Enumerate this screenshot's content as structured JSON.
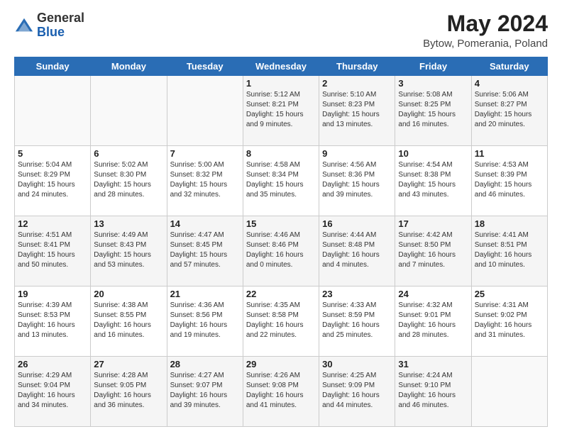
{
  "logo": {
    "text_general": "General",
    "text_blue": "Blue"
  },
  "header": {
    "title": "May 2024",
    "subtitle": "Bytow, Pomerania, Poland"
  },
  "days_of_week": [
    "Sunday",
    "Monday",
    "Tuesday",
    "Wednesday",
    "Thursday",
    "Friday",
    "Saturday"
  ],
  "weeks": [
    [
      {
        "day": "",
        "sunrise": "",
        "sunset": "",
        "daylight": ""
      },
      {
        "day": "",
        "sunrise": "",
        "sunset": "",
        "daylight": ""
      },
      {
        "day": "",
        "sunrise": "",
        "sunset": "",
        "daylight": ""
      },
      {
        "day": "1",
        "sunrise": "Sunrise: 5:12 AM",
        "sunset": "Sunset: 8:21 PM",
        "daylight": "Daylight: 15 hours and 9 minutes."
      },
      {
        "day": "2",
        "sunrise": "Sunrise: 5:10 AM",
        "sunset": "Sunset: 8:23 PM",
        "daylight": "Daylight: 15 hours and 13 minutes."
      },
      {
        "day": "3",
        "sunrise": "Sunrise: 5:08 AM",
        "sunset": "Sunset: 8:25 PM",
        "daylight": "Daylight: 15 hours and 16 minutes."
      },
      {
        "day": "4",
        "sunrise": "Sunrise: 5:06 AM",
        "sunset": "Sunset: 8:27 PM",
        "daylight": "Daylight: 15 hours and 20 minutes."
      }
    ],
    [
      {
        "day": "5",
        "sunrise": "Sunrise: 5:04 AM",
        "sunset": "Sunset: 8:29 PM",
        "daylight": "Daylight: 15 hours and 24 minutes."
      },
      {
        "day": "6",
        "sunrise": "Sunrise: 5:02 AM",
        "sunset": "Sunset: 8:30 PM",
        "daylight": "Daylight: 15 hours and 28 minutes."
      },
      {
        "day": "7",
        "sunrise": "Sunrise: 5:00 AM",
        "sunset": "Sunset: 8:32 PM",
        "daylight": "Daylight: 15 hours and 32 minutes."
      },
      {
        "day": "8",
        "sunrise": "Sunrise: 4:58 AM",
        "sunset": "Sunset: 8:34 PM",
        "daylight": "Daylight: 15 hours and 35 minutes."
      },
      {
        "day": "9",
        "sunrise": "Sunrise: 4:56 AM",
        "sunset": "Sunset: 8:36 PM",
        "daylight": "Daylight: 15 hours and 39 minutes."
      },
      {
        "day": "10",
        "sunrise": "Sunrise: 4:54 AM",
        "sunset": "Sunset: 8:38 PM",
        "daylight": "Daylight: 15 hours and 43 minutes."
      },
      {
        "day": "11",
        "sunrise": "Sunrise: 4:53 AM",
        "sunset": "Sunset: 8:39 PM",
        "daylight": "Daylight: 15 hours and 46 minutes."
      }
    ],
    [
      {
        "day": "12",
        "sunrise": "Sunrise: 4:51 AM",
        "sunset": "Sunset: 8:41 PM",
        "daylight": "Daylight: 15 hours and 50 minutes."
      },
      {
        "day": "13",
        "sunrise": "Sunrise: 4:49 AM",
        "sunset": "Sunset: 8:43 PM",
        "daylight": "Daylight: 15 hours and 53 minutes."
      },
      {
        "day": "14",
        "sunrise": "Sunrise: 4:47 AM",
        "sunset": "Sunset: 8:45 PM",
        "daylight": "Daylight: 15 hours and 57 minutes."
      },
      {
        "day": "15",
        "sunrise": "Sunrise: 4:46 AM",
        "sunset": "Sunset: 8:46 PM",
        "daylight": "Daylight: 16 hours and 0 minutes."
      },
      {
        "day": "16",
        "sunrise": "Sunrise: 4:44 AM",
        "sunset": "Sunset: 8:48 PM",
        "daylight": "Daylight: 16 hours and 4 minutes."
      },
      {
        "day": "17",
        "sunrise": "Sunrise: 4:42 AM",
        "sunset": "Sunset: 8:50 PM",
        "daylight": "Daylight: 16 hours and 7 minutes."
      },
      {
        "day": "18",
        "sunrise": "Sunrise: 4:41 AM",
        "sunset": "Sunset: 8:51 PM",
        "daylight": "Daylight: 16 hours and 10 minutes."
      }
    ],
    [
      {
        "day": "19",
        "sunrise": "Sunrise: 4:39 AM",
        "sunset": "Sunset: 8:53 PM",
        "daylight": "Daylight: 16 hours and 13 minutes."
      },
      {
        "day": "20",
        "sunrise": "Sunrise: 4:38 AM",
        "sunset": "Sunset: 8:55 PM",
        "daylight": "Daylight: 16 hours and 16 minutes."
      },
      {
        "day": "21",
        "sunrise": "Sunrise: 4:36 AM",
        "sunset": "Sunset: 8:56 PM",
        "daylight": "Daylight: 16 hours and 19 minutes."
      },
      {
        "day": "22",
        "sunrise": "Sunrise: 4:35 AM",
        "sunset": "Sunset: 8:58 PM",
        "daylight": "Daylight: 16 hours and 22 minutes."
      },
      {
        "day": "23",
        "sunrise": "Sunrise: 4:33 AM",
        "sunset": "Sunset: 8:59 PM",
        "daylight": "Daylight: 16 hours and 25 minutes."
      },
      {
        "day": "24",
        "sunrise": "Sunrise: 4:32 AM",
        "sunset": "Sunset: 9:01 PM",
        "daylight": "Daylight: 16 hours and 28 minutes."
      },
      {
        "day": "25",
        "sunrise": "Sunrise: 4:31 AM",
        "sunset": "Sunset: 9:02 PM",
        "daylight": "Daylight: 16 hours and 31 minutes."
      }
    ],
    [
      {
        "day": "26",
        "sunrise": "Sunrise: 4:29 AM",
        "sunset": "Sunset: 9:04 PM",
        "daylight": "Daylight: 16 hours and 34 minutes."
      },
      {
        "day": "27",
        "sunrise": "Sunrise: 4:28 AM",
        "sunset": "Sunset: 9:05 PM",
        "daylight": "Daylight: 16 hours and 36 minutes."
      },
      {
        "day": "28",
        "sunrise": "Sunrise: 4:27 AM",
        "sunset": "Sunset: 9:07 PM",
        "daylight": "Daylight: 16 hours and 39 minutes."
      },
      {
        "day": "29",
        "sunrise": "Sunrise: 4:26 AM",
        "sunset": "Sunset: 9:08 PM",
        "daylight": "Daylight: 16 hours and 41 minutes."
      },
      {
        "day": "30",
        "sunrise": "Sunrise: 4:25 AM",
        "sunset": "Sunset: 9:09 PM",
        "daylight": "Daylight: 16 hours and 44 minutes."
      },
      {
        "day": "31",
        "sunrise": "Sunrise: 4:24 AM",
        "sunset": "Sunset: 9:10 PM",
        "daylight": "Daylight: 16 hours and 46 minutes."
      },
      {
        "day": "",
        "sunrise": "",
        "sunset": "",
        "daylight": ""
      }
    ]
  ]
}
